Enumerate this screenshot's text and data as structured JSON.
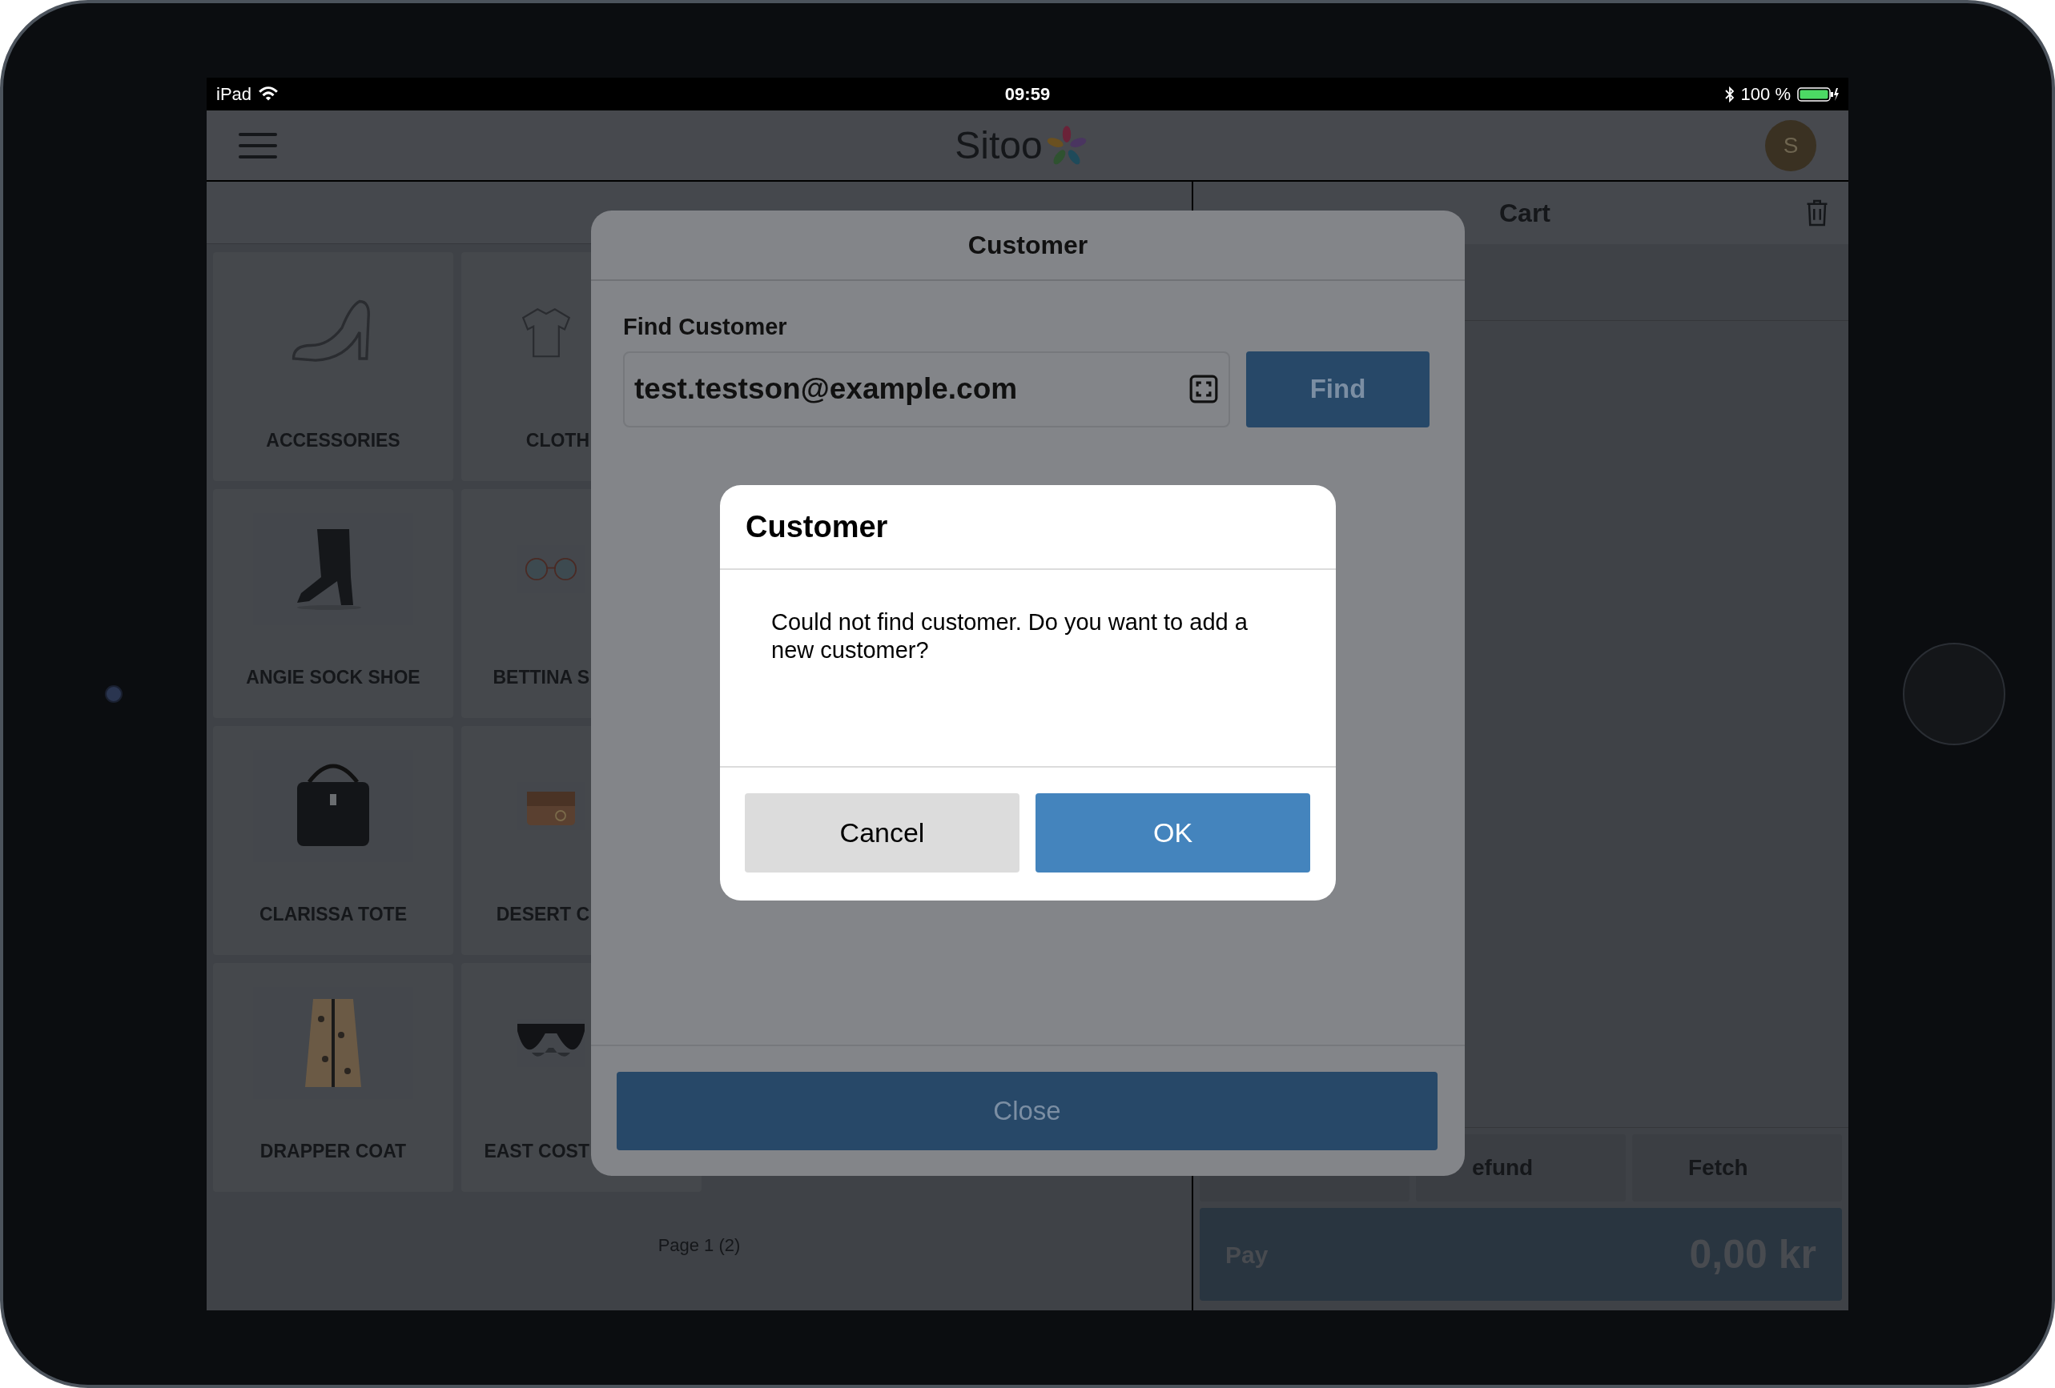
{
  "status_bar": {
    "device": "iPad",
    "time": "09:59",
    "battery": "100 %"
  },
  "nav": {
    "logo": "Sitoo",
    "avatar": "S"
  },
  "products": {
    "tiles": [
      {
        "label": "ACCESSORIES",
        "kind": "shoe"
      },
      {
        "label": "CLOTH",
        "kind": "shirt"
      },
      {
        "label": "ANGIE SOCK SHOE",
        "kind": "picture"
      },
      {
        "label": "BETTINA S",
        "kind": "picture"
      },
      {
        "label": "CLARISSA TOTE",
        "kind": "picture"
      },
      {
        "label": "DESERT C",
        "kind": "picture"
      },
      {
        "label": "DRAPPER COAT",
        "kind": "picture"
      },
      {
        "label": "EAST COST",
        "kind": "picture"
      }
    ],
    "page": "Page 1 (2)"
  },
  "cart": {
    "title": "Cart",
    "actions": [
      "efund",
      "Fetch"
    ],
    "pay": "Pay",
    "total": "0,00 kr"
  },
  "modal": {
    "title": "Customer",
    "field_label": "Find Customer",
    "field_value": "test.testson@example.com",
    "find": "Find",
    "close": "Close"
  },
  "alert": {
    "title": "Customer",
    "message": "Could not find customer. Do you want to add a new customer?",
    "buttons": [
      {
        "label": "Cancel",
        "kind": "secondary"
      },
      {
        "label": "OK",
        "kind": "primary"
      }
    ]
  }
}
